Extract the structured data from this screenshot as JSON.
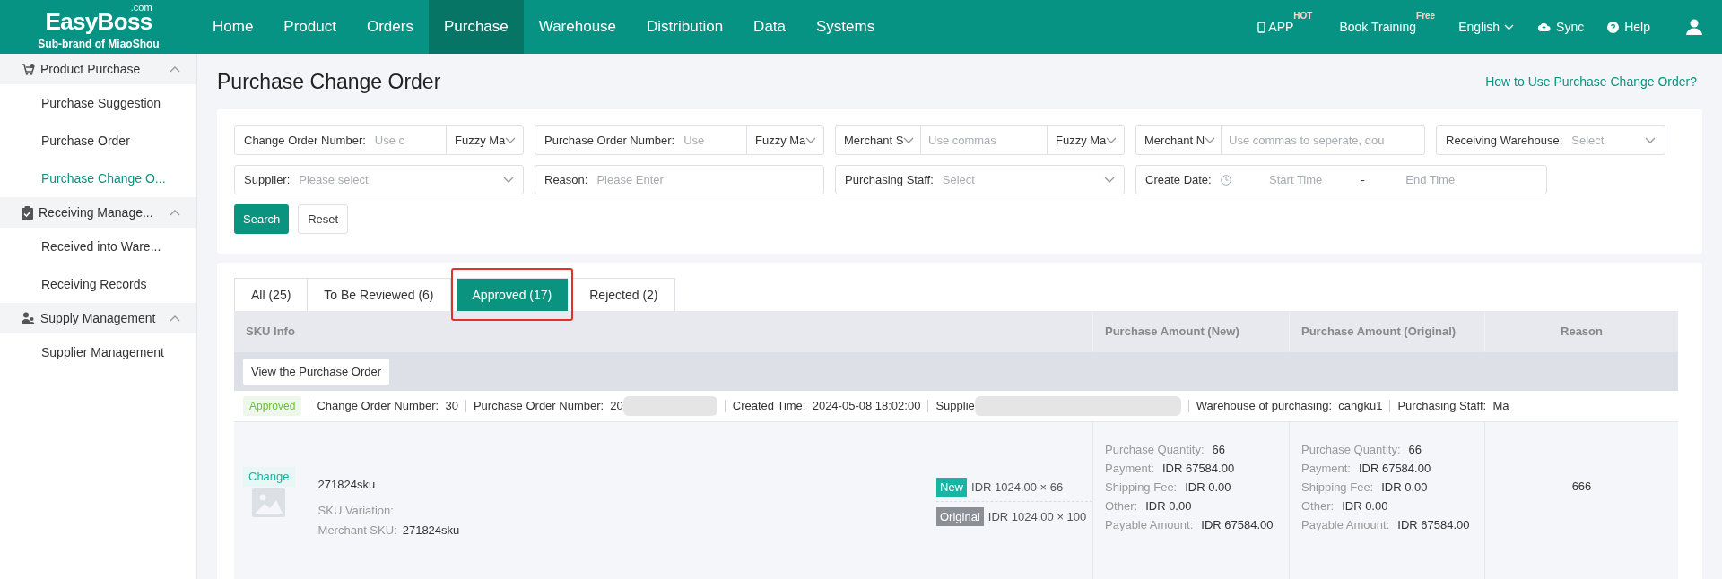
{
  "logo": {
    "name": "EasyBoss",
    "suffix": ".com",
    "tagline": "Sub-brand of MiaoShou"
  },
  "nav": [
    {
      "label": "Home",
      "selected": false
    },
    {
      "label": "Product",
      "selected": false
    },
    {
      "label": "Orders",
      "selected": false
    },
    {
      "label": "Purchase",
      "selected": true
    },
    {
      "label": "Warehouse",
      "selected": false
    },
    {
      "label": "Distribution",
      "selected": false
    },
    {
      "label": "Data",
      "selected": false
    },
    {
      "label": "Systems",
      "selected": false
    }
  ],
  "header_actions": [
    {
      "kind": "app",
      "label": "APP",
      "badge": "HOT"
    },
    {
      "kind": "training",
      "label": "Book Training",
      "badge": "Free"
    },
    {
      "kind": "language",
      "label": "English"
    },
    {
      "kind": "sync",
      "label": "Sync"
    },
    {
      "kind": "help",
      "label": "Help"
    },
    {
      "kind": "user"
    }
  ],
  "sidebar": [
    {
      "label": "Product Purchase",
      "expanded": true,
      "children": [
        {
          "label": "Purchase Suggestion",
          "selected": false
        },
        {
          "label": "Purchase Order",
          "selected": false
        },
        {
          "label": "Purchase Change O...",
          "selected": true
        }
      ]
    },
    {
      "label": "Receiving Manage...",
      "expanded": true,
      "children": [
        {
          "label": "Received into Ware...",
          "selected": false
        },
        {
          "label": "Receiving Records",
          "selected": false
        }
      ]
    },
    {
      "label": "Supply Management",
      "expanded": true,
      "children": [
        {
          "label": "Supplier Management",
          "selected": false
        }
      ]
    }
  ],
  "page": {
    "title": "Purchase Change Order",
    "help_link": "How to Use Purchase Change Order?"
  },
  "filters": [
    [
      {
        "kind": "text_match",
        "label": "Change Order Number:",
        "placeholder": "Use c",
        "match": "Fuzzy Ma"
      },
      {
        "kind": "text_match",
        "label": "Purchase Order Number:",
        "placeholder": "Use",
        "match": "Fuzzy Ma"
      },
      {
        "kind": "select_text_match",
        "select": "Merchant S",
        "placeholder": "Use commas",
        "match": "Fuzzy Ma"
      },
      {
        "kind": "select_text",
        "select": "Merchant N",
        "placeholder": "Use commas to seperate, dou"
      },
      {
        "kind": "select",
        "label": "Receiving Warehouse:",
        "placeholder": "Select"
      }
    ],
    [
      {
        "kind": "select",
        "label": "Supplier:",
        "placeholder": "Please select"
      },
      {
        "kind": "text",
        "label": "Reason:",
        "placeholder": "Please Enter"
      },
      {
        "kind": "select",
        "label": "Purchasing Staff:",
        "placeholder": "Select"
      },
      {
        "kind": "date_range",
        "label": "Create Date:",
        "start": "Start Time",
        "separator": "-",
        "end": "End Time"
      }
    ]
  ],
  "filter_buttons": [
    {
      "kind": "primary",
      "label": "Search"
    },
    {
      "kind": "default",
      "label": "Reset"
    }
  ],
  "tabs": [
    {
      "label": "All (25)",
      "selected": false,
      "highlighted": false
    },
    {
      "label": "To Be Reviewed (6)",
      "selected": false,
      "highlighted": false
    },
    {
      "label": "Approved (17)",
      "selected": true,
      "highlighted": true
    },
    {
      "label": "Rejected (2)",
      "selected": false,
      "highlighted": false
    }
  ],
  "table": {
    "columns": [
      "SKU Info",
      "Purchase Amount (New)",
      "Purchase Amount (Original)",
      "Reason"
    ],
    "order_button": "View the Purchase Order",
    "order_info": {
      "status": "Approved",
      "fields": [
        {
          "label": "Change Order Number:",
          "value": "30",
          "redacted": false
        },
        {
          "label": "Purchase Order Number:",
          "value": "20",
          "redacted": true
        },
        {
          "label": "Created Time:",
          "value": "2024-05-08 18:02:00",
          "redacted": false
        },
        {
          "label": "Supplie",
          "redacted": true
        },
        {
          "label": "Warehouse of purchasing:",
          "value": "cangku1",
          "redacted": false
        },
        {
          "label": "Purchasing Staff:",
          "value": "Ma",
          "redacted": false
        }
      ]
    },
    "rows": [
      {
        "tag": "Change",
        "sku": "271824sku",
        "variation_label": "SKU Variation:",
        "merchant_sku_label": "Merchant SKU:",
        "merchant_sku": "271824sku",
        "prices": [
          {
            "kind": "new",
            "badge": "New",
            "text": "IDR 1024.00 × 66"
          },
          {
            "kind": "original",
            "badge": "Original",
            "text": "IDR 1024.00 × 100"
          }
        ],
        "amount_new": [
          {
            "label": "Purchase Quantity:",
            "value": "66"
          },
          {
            "label": "Payment:",
            "value": "IDR 67584.00"
          },
          {
            "label": "Shipping Fee:",
            "value": "IDR 0.00"
          },
          {
            "label": "Other:",
            "value": "IDR 0.00"
          },
          {
            "label": "Payable Amount:",
            "value": "IDR 67584.00"
          }
        ],
        "amount_original": [
          {
            "label": "Purchase Quantity:",
            "value": "66"
          },
          {
            "label": "Payment:",
            "value": "IDR 67584.00"
          },
          {
            "label": "Shipping Fee:",
            "value": "IDR 0.00"
          },
          {
            "label": "Other:",
            "value": "IDR 0.00"
          },
          {
            "label": "Payable Amount:",
            "value": "IDR 67584.00"
          }
        ],
        "reason": "666"
      }
    ]
  }
}
